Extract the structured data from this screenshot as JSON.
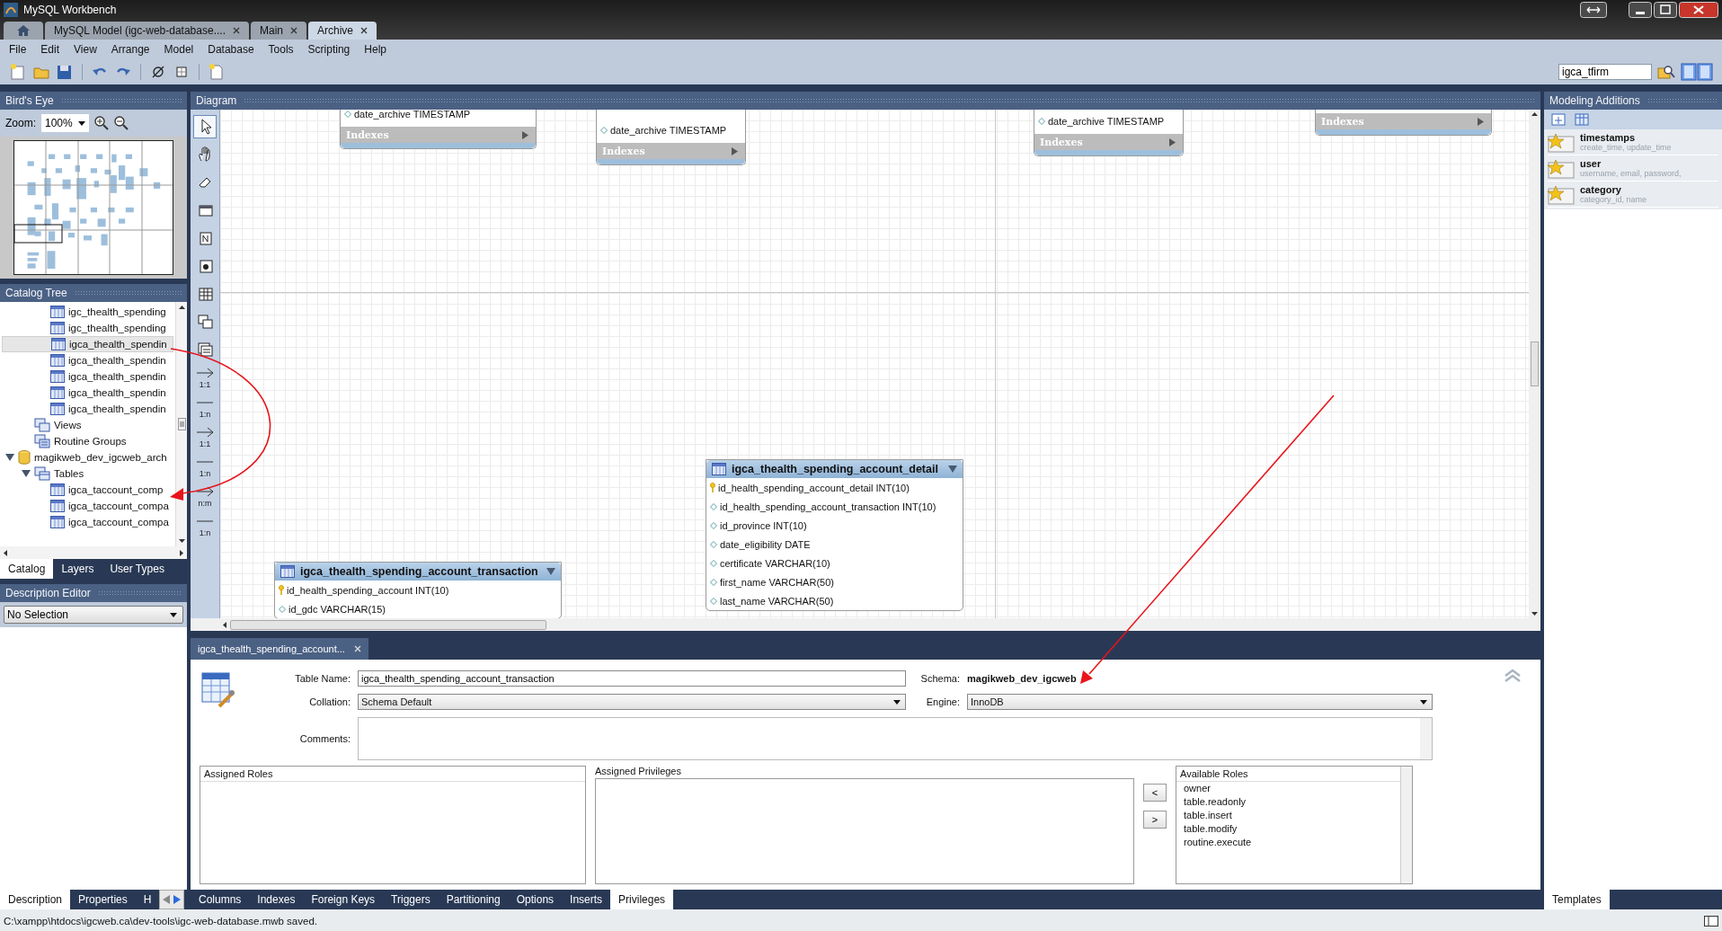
{
  "window": {
    "title": "MySQL Workbench"
  },
  "doc_tabs": [
    {
      "label": "MySQL Model (igc-web-database....",
      "selected": false
    },
    {
      "label": "Main",
      "selected": false
    },
    {
      "label": "Archive",
      "selected": true
    }
  ],
  "menu": [
    "File",
    "Edit",
    "View",
    "Arrange",
    "Model",
    "Database",
    "Tools",
    "Scripting",
    "Help"
  ],
  "search": {
    "value": "igca_tfirm"
  },
  "birds_eye": {
    "title": "Bird's Eye",
    "zoom_label": "Zoom:",
    "zoom_value": "100%"
  },
  "catalog": {
    "title": "Catalog Tree",
    "tree": [
      {
        "kind": "group",
        "children": [
          {
            "kind": "group",
            "children": [
              {
                "kind": "table",
                "label": "igc_thealth_spending",
                "selected": false
              },
              {
                "kind": "table",
                "label": "igc_thealth_spending",
                "selected": false
              },
              {
                "kind": "table",
                "label": "igca_thealth_spendin",
                "selected": true
              },
              {
                "kind": "table",
                "label": "igca_thealth_spendin",
                "selected": false
              },
              {
                "kind": "table",
                "label": "igca_thealth_spendin",
                "selected": false
              },
              {
                "kind": "table",
                "label": "igca_thealth_spendin",
                "selected": false
              },
              {
                "kind": "table",
                "label": "igca_thealth_spendin",
                "selected": false
              }
            ]
          },
          {
            "kind": "views",
            "label": "Views",
            "selected": false
          },
          {
            "kind": "routines",
            "label": "Routine Groups",
            "selected": false
          }
        ]
      },
      {
        "kind": "schema",
        "label": "magikweb_dev_igcweb_arch",
        "expanded": true,
        "selected": false,
        "children": [
          {
            "kind": "folder",
            "label": "Tables",
            "expanded": true,
            "selected": false,
            "children": [
              {
                "kind": "table",
                "label": "igca_taccount_comp",
                "selected": false
              },
              {
                "kind": "table",
                "label": "igca_taccount_compa",
                "selected": false
              },
              {
                "kind": "table",
                "label": "igca_taccount_compa",
                "selected": false
              }
            ]
          }
        ]
      }
    ],
    "tabs": [
      {
        "label": "Catalog",
        "selected": true
      },
      {
        "label": "Layers",
        "selected": false
      },
      {
        "label": "User Types",
        "selected": false
      }
    ]
  },
  "description_editor": {
    "title": "Description Editor",
    "selection": "No Selection",
    "tabs": [
      {
        "label": "Description",
        "selected": true
      },
      {
        "label": "Properties",
        "selected": false
      },
      {
        "label": "H",
        "selected": false
      }
    ]
  },
  "diagram": {
    "title": "Diagram",
    "tools": [
      {
        "kind": "pointer",
        "selected": true
      },
      {
        "kind": "hand",
        "selected": false
      },
      {
        "kind": "eraser",
        "selected": false
      },
      {
        "kind": "layer",
        "selected": false
      },
      {
        "kind": "note",
        "selected": false
      },
      {
        "kind": "image",
        "selected": false
      },
      {
        "kind": "table",
        "selected": false
      },
      {
        "kind": "view",
        "selected": false
      },
      {
        "kind": "routine",
        "selected": false
      },
      {
        "kind": "relation",
        "label": "1:1",
        "selected": false
      },
      {
        "kind": "relation",
        "label": "1:n",
        "selected": false
      },
      {
        "kind": "relation",
        "label": "1:1",
        "selected": false
      },
      {
        "kind": "relation",
        "label": "1:n",
        "selected": false
      },
      {
        "kind": "relation",
        "label": "n:m",
        "selected": false
      },
      {
        "kind": "relation",
        "label": "1:n",
        "selected": false
      }
    ],
    "tables": [
      {
        "kind": "cut",
        "columns": [
          {
            "name": "date_archive TIMESTAMP",
            "primary": false
          }
        ],
        "indexes": "Indexes"
      },
      {
        "kind": "cut",
        "columns": [
          {
            "name": "date_archive TIMESTAMP",
            "primary": false
          }
        ],
        "indexes": "Indexes"
      },
      {
        "kind": "cut",
        "columns": [
          {
            "name": "date_archive TIMESTAMP",
            "primary": false
          }
        ],
        "indexes": "Indexes"
      },
      {
        "kind": "cut",
        "indexes": "Indexes"
      },
      {
        "kind": "full",
        "name": "igca_thealth_spending_account_detail",
        "columns": [
          {
            "name": "id_health_spending_account_detail INT(10)",
            "primary": true
          },
          {
            "name": "id_health_spending_account_transaction INT(10)",
            "primary": false
          },
          {
            "name": "id_province INT(10)",
            "primary": false
          },
          {
            "name": "date_eligibility DATE",
            "primary": false
          },
          {
            "name": "certificate VARCHAR(10)",
            "primary": false
          },
          {
            "name": "first_name VARCHAR(50)",
            "primary": false
          },
          {
            "name": "last_name VARCHAR(50)",
            "primary": false
          }
        ]
      },
      {
        "kind": "full",
        "name": "igca_thealth_spending_account_transaction",
        "columns": [
          {
            "name": "id_health_spending_account INT(10)",
            "primary": true
          },
          {
            "name": "id_gdc VARCHAR(15)",
            "primary": false
          }
        ]
      }
    ]
  },
  "editor": {
    "tab": "igca_thealth_spending_account...",
    "table_name_label": "Table Name:",
    "table_name": "igca_thealth_spending_account_transaction",
    "schema_label": "Schema:",
    "schema": "magikweb_dev_igcweb",
    "collation_label": "Collation:",
    "collation": "Schema Default",
    "engine_label": "Engine:",
    "engine": "InnoDB",
    "comments_label": "Comments:",
    "assigned_roles": "Assigned Roles",
    "assigned_privileges": "Assigned Privileges",
    "move_buttons": [
      "<",
      ">"
    ],
    "available_roles": {
      "title": "Available Roles",
      "items": [
        "owner",
        "table.readonly",
        "table.insert",
        "table.modify",
        "routine.execute"
      ]
    },
    "tabs": [
      {
        "label": "Columns",
        "selected": false
      },
      {
        "label": "Indexes",
        "selected": false
      },
      {
        "label": "Foreign Keys",
        "selected": false
      },
      {
        "label": "Triggers",
        "selected": false
      },
      {
        "label": "Partitioning",
        "selected": false
      },
      {
        "label": "Options",
        "selected": false
      },
      {
        "label": "Inserts",
        "selected": false
      },
      {
        "label": "Privileges",
        "selected": true
      }
    ]
  },
  "modeling_additions": {
    "title": "Modeling Additions",
    "items": [
      {
        "name": "timestamps",
        "detail": "create_time, update_time"
      },
      {
        "name": "user",
        "detail": "username, email, password,"
      },
      {
        "name": "category",
        "detail": "category_id, name"
      }
    ],
    "tabs": [
      {
        "label": "Templates",
        "selected": true
      }
    ]
  },
  "status_bar": "C:\\xampp\\htdocs\\igcweb.ca\\dev-tools\\igc-web-database.mwb saved."
}
